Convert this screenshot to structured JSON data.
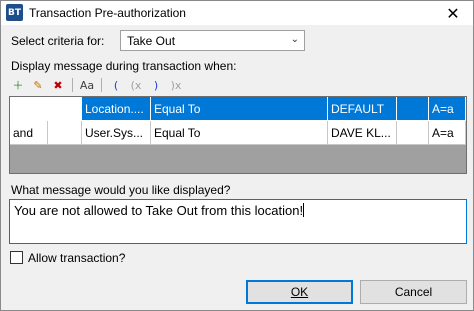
{
  "window": {
    "icon_text": "BT",
    "title": "Transaction Pre-authorization",
    "close_glyph": "✕"
  },
  "criteria": {
    "label": "Select criteria for:",
    "selected": "Take Out"
  },
  "conditions": {
    "label": "Display message during transaction when:",
    "toolbar": [
      {
        "name": "add-condition-icon",
        "glyph": "＋",
        "color": "#2e8b2e"
      },
      {
        "name": "edit-condition-icon",
        "glyph": "✎",
        "color": "#c07000"
      },
      {
        "name": "delete-condition-icon",
        "glyph": "✖",
        "color": "#c00000"
      },
      {
        "name": "case-icon",
        "glyph": "Aa",
        "color": "#404040"
      },
      {
        "name": "open-paren-icon",
        "glyph": "(",
        "color": "#1a3fd0"
      },
      {
        "name": "open-paren-disabled-icon",
        "glyph": "(x",
        "color": "#a0a0a0"
      },
      {
        "name": "close-paren-icon",
        "glyph": ")",
        "color": "#1a3fd0"
      },
      {
        "name": "close-paren-disabled-icon",
        "glyph": ")x",
        "color": "#a0a0a0"
      }
    ],
    "rows": [
      {
        "join": "",
        "open": "",
        "field": "Location....",
        "operator": "Equal To",
        "value": "DEFAULT",
        "close": "",
        "case": "A=a",
        "selected": true
      },
      {
        "join": "and",
        "open": "",
        "field": "User.Sys...",
        "operator": "Equal To",
        "value": "DAVE KL...",
        "close": "",
        "case": "A=a",
        "selected": false
      }
    ]
  },
  "message": {
    "label": "What message would you like displayed?",
    "value": "You are not allowed to Take Out from this location!"
  },
  "allow": {
    "label": "Allow transaction?",
    "checked": false
  },
  "buttons": {
    "ok": "OK",
    "cancel": "Cancel"
  }
}
